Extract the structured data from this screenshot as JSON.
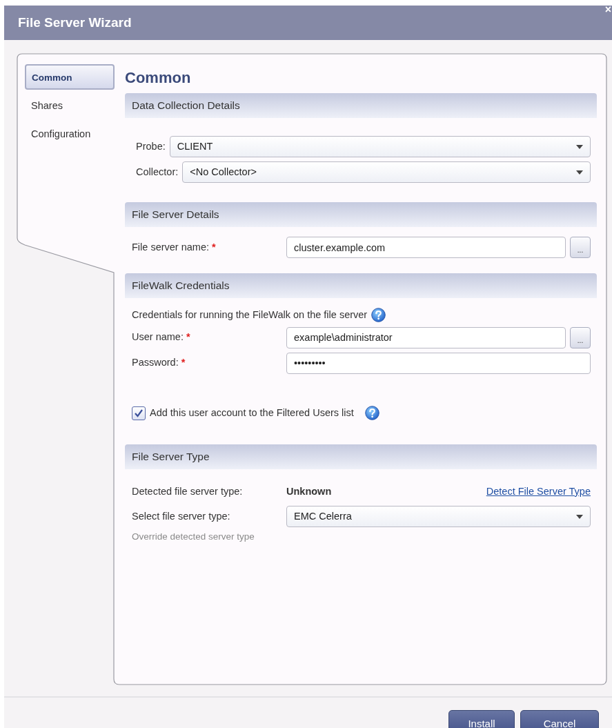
{
  "window": {
    "title": "File Server Wizard",
    "close": "×"
  },
  "nav": [
    {
      "label": "Common",
      "selected": true
    },
    {
      "label": "Shares",
      "selected": false
    },
    {
      "label": "Configuration",
      "selected": false
    }
  ],
  "page_title": "Common",
  "sections": [
    {
      "title": "Data Collection Details",
      "rows": [
        {
          "kind": "select",
          "label": "Probe:",
          "value": "CLIENT"
        },
        {
          "kind": "select",
          "label": "Collector:",
          "value": "<No Collector>"
        }
      ]
    },
    {
      "title": "File Server Details",
      "rows": [
        {
          "kind": "text",
          "label": "File server name:",
          "required_mark": "*",
          "value": "cluster.example.com",
          "browse": "..."
        }
      ]
    },
    {
      "title": "FileWalk Credentials",
      "rows": [
        {
          "kind": "note",
          "text": "Credentials for running the FileWalk on the file server",
          "help": true
        },
        {
          "kind": "text",
          "label": "User name:",
          "required_mark": "*",
          "value": "example\\administrator",
          "browse": "..."
        },
        {
          "kind": "text",
          "label": "Password:",
          "required_mark": "*",
          "value": "•••••••••"
        },
        {
          "kind": "checkbox",
          "label": "Add this user account to the Filtered Users list",
          "checked": true,
          "help": true
        }
      ]
    },
    {
      "title": "File Server Type",
      "rows": [
        {
          "kind": "detected",
          "label": "Detected file server type:",
          "value": "Unknown",
          "link": "Detect File Server Type"
        },
        {
          "kind": "select",
          "label": "Select file server type:",
          "value": "EMC Celerra",
          "hint": "Override detected server type"
        }
      ]
    }
  ],
  "buttons": [
    "Install",
    "Cancel"
  ]
}
